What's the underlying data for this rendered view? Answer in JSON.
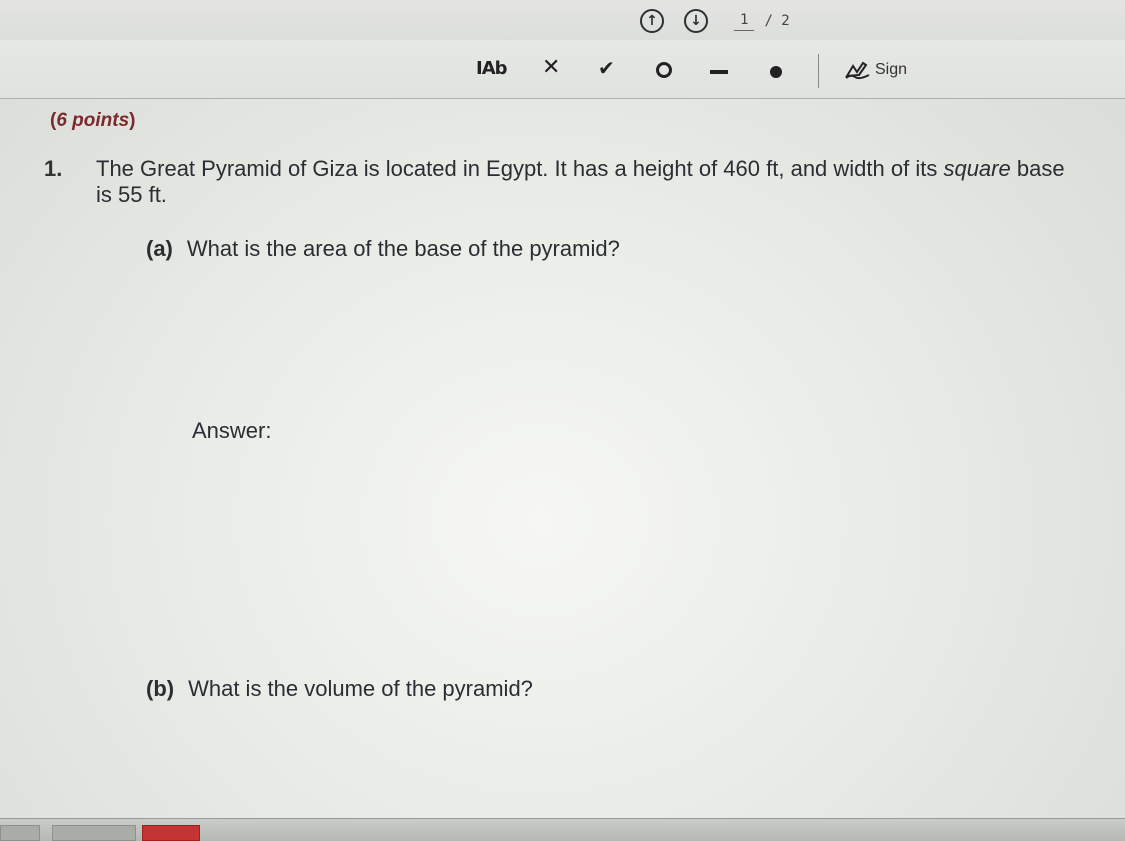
{
  "pager": {
    "current": "1",
    "total": "/ 2",
    "prev_icon": "arrow-up-circle-icon",
    "next_icon": "arrow-down-circle-icon"
  },
  "toolbar": {
    "tools": [
      "text-tool-icon",
      "cross-mark-icon",
      "check-mark-icon",
      "circle-icon",
      "line-icon",
      "dot-icon"
    ],
    "text_tool_label": "IAb",
    "sign_label": "Sign"
  },
  "document": {
    "points": "6 points",
    "question_number": "1.",
    "question_text_1": "The Great Pyramid of Giza is located in Egypt. It has a height of 460 ft, and width of its",
    "question_text_italic": "square",
    "question_text_2": " base is 55 ft.",
    "part_a_label": "(a)",
    "part_a_text": "What is the area of the base of the pyramid?",
    "answer_label": "Answer:",
    "part_b_label": "(b)",
    "part_b_text": "What is the volume of the pyramid?"
  },
  "colors": {
    "points_text": "#7a2a2c",
    "body_text": "#2a2e33"
  }
}
